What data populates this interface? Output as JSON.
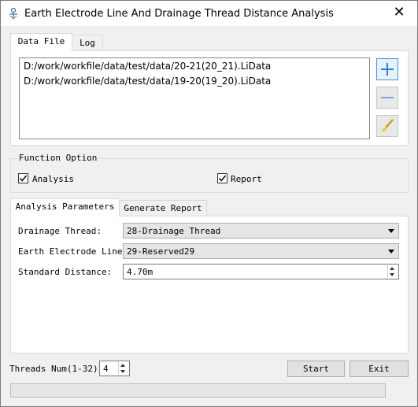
{
  "window": {
    "title": "Earth Electrode Line And Drainage Thread Distance Analysis",
    "close_glyph": "✕"
  },
  "top_tabs": [
    {
      "label": "Data File"
    },
    {
      "label": "Log"
    }
  ],
  "data_files": [
    "D:/work/workfile/data/test/data/20-21(20_21).LiData",
    "D:/work/workfile/data/test/data/19-20(19_20).LiData"
  ],
  "icons": {
    "add": "plus-icon",
    "remove": "minus-icon",
    "clear": "brush-icon",
    "accent": "#2f7bd6"
  },
  "function_option": {
    "title": "Function Option",
    "analysis_label": "Analysis",
    "analysis_checked": true,
    "report_label": "Report",
    "report_checked": true
  },
  "param_tabs": [
    {
      "label": "Analysis Parameters"
    },
    {
      "label": "Generate Report"
    }
  ],
  "params": {
    "drainage_label": "Drainage Thread:",
    "drainage_value": "28-Drainage Thread",
    "electrode_label": "Earth Electrode Line:",
    "electrode_value": "29-Reserved29",
    "distance_label": "Standard Distance:",
    "distance_value": "4.70m"
  },
  "threads": {
    "label": "Threads Num(1-32):",
    "value": "4"
  },
  "buttons": {
    "start": "Start",
    "exit": "Exit"
  },
  "progress": {
    "value": 0
  }
}
